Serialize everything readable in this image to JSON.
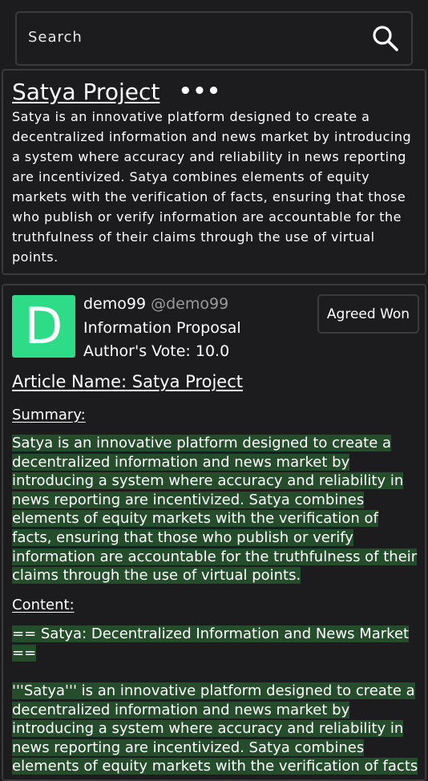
{
  "search": {
    "placeholder": "Search"
  },
  "project": {
    "title": "Satya Project",
    "more": "•••",
    "description": "Satya is an innovative platform designed to create a decentralized information and news market by introducing a system where accuracy and reliability in news reporting are incentivized. Satya combines elements of equity markets with the verification of facts, ensuring that those who publish or verify information are accountable for the truthfulness of their claims through the use of virtual points."
  },
  "post": {
    "avatar_letter": "D",
    "avatar_color": "#2edc88",
    "author_name": "demo99",
    "author_handle": "@demo99",
    "proposal_type": "Information Proposal",
    "author_vote": "Author's Vote: 10.0",
    "status": "Agreed Won",
    "article_name": "Article Name: Satya Project",
    "summary_label": "Summary:",
    "summary_text": "Satya is an innovative platform designed to create a decentralized information and news market by introducing a system where accuracy and reliability in news reporting are incentivized. Satya combines elements of equity markets with the verification of facts, ensuring that those who publish or verify information are accountable for the truthfulness of their claims through the use of virtual points.",
    "content_label": "Content:",
    "content_heading": "== Satya: Decentralized Information and News Market ==",
    "content_text": "'''Satya''' is an innovative platform designed to create a decentralized information and news market by introducing a system where accuracy and reliability in news reporting are incentivized. Satya combines elements of equity markets with the verification of facts",
    "highlight_color": "#254d2b"
  }
}
